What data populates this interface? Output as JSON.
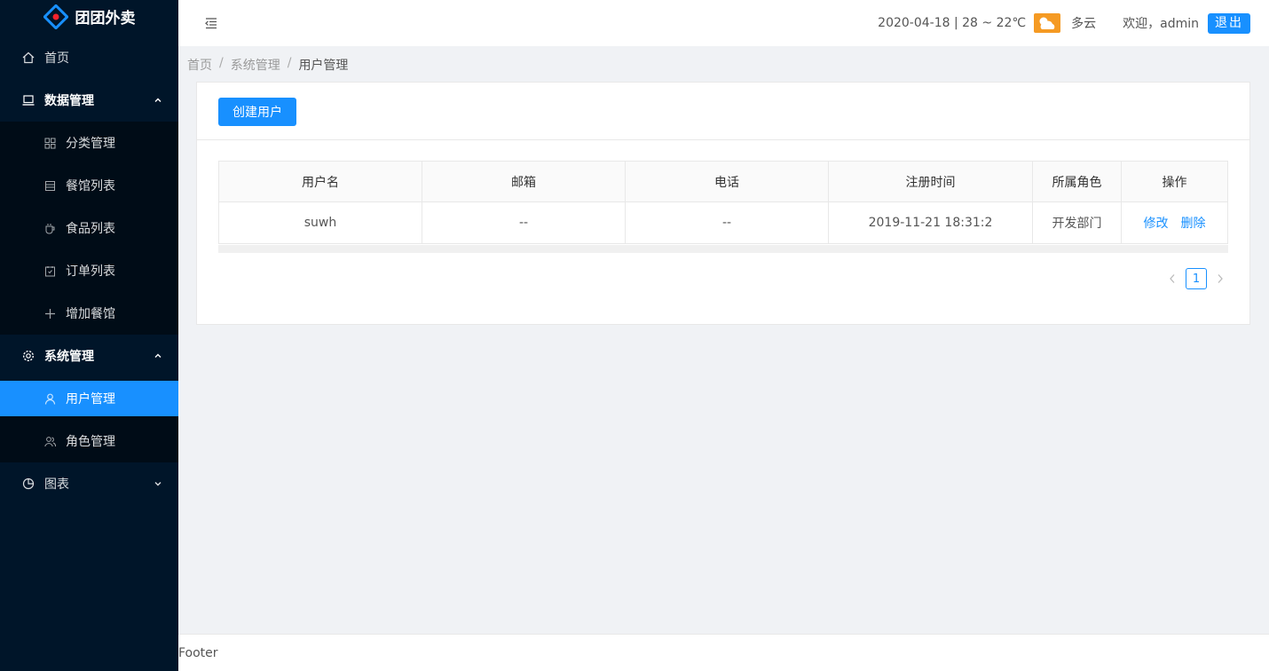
{
  "app": {
    "title": "团团外卖"
  },
  "sidebar": {
    "items": [
      {
        "label": "首页",
        "icon": "home-icon"
      },
      {
        "label": "数据管理",
        "icon": "laptop-icon",
        "expanded": true,
        "children": [
          {
            "label": "分类管理",
            "icon": "appstore-icon"
          },
          {
            "label": "餐馆列表",
            "icon": "database-icon"
          },
          {
            "label": "食品列表",
            "icon": "coffee-icon"
          },
          {
            "label": "订单列表",
            "icon": "order-icon"
          },
          {
            "label": "增加餐馆",
            "icon": "plus-icon"
          }
        ]
      },
      {
        "label": "系统管理",
        "icon": "setting-icon",
        "expanded": true,
        "children": [
          {
            "label": "用户管理",
            "icon": "user-icon",
            "selected": true
          },
          {
            "label": "角色管理",
            "icon": "team-icon"
          }
        ]
      },
      {
        "label": "图表",
        "icon": "pie-chart-icon",
        "expanded": false
      }
    ]
  },
  "header": {
    "date_weather": "2020-04-18 | 28 ~ 22℃",
    "weather": "多云",
    "welcome": "欢迎，admin",
    "logout": "退出"
  },
  "breadcrumb": [
    "首页",
    "系统管理",
    "用户管理"
  ],
  "card": {
    "create_button": "创建用户"
  },
  "table": {
    "columns": [
      "用户名",
      "邮箱",
      "电话",
      "注册时间",
      "所属角色",
      "操作"
    ],
    "rows": [
      {
        "username": "suwh",
        "email": "--",
        "phone": "--",
        "created": "2019-11-21 18:31:2",
        "role": "开发部门",
        "actions": [
          "修改",
          "删除"
        ]
      }
    ]
  },
  "pagination": {
    "current": "1"
  },
  "footer": {
    "text": "Footer"
  },
  "colors": {
    "primary": "#1890ff",
    "sidebar_bg": "#001529",
    "submenu_bg": "#000c17",
    "weather": "#f59a23"
  }
}
